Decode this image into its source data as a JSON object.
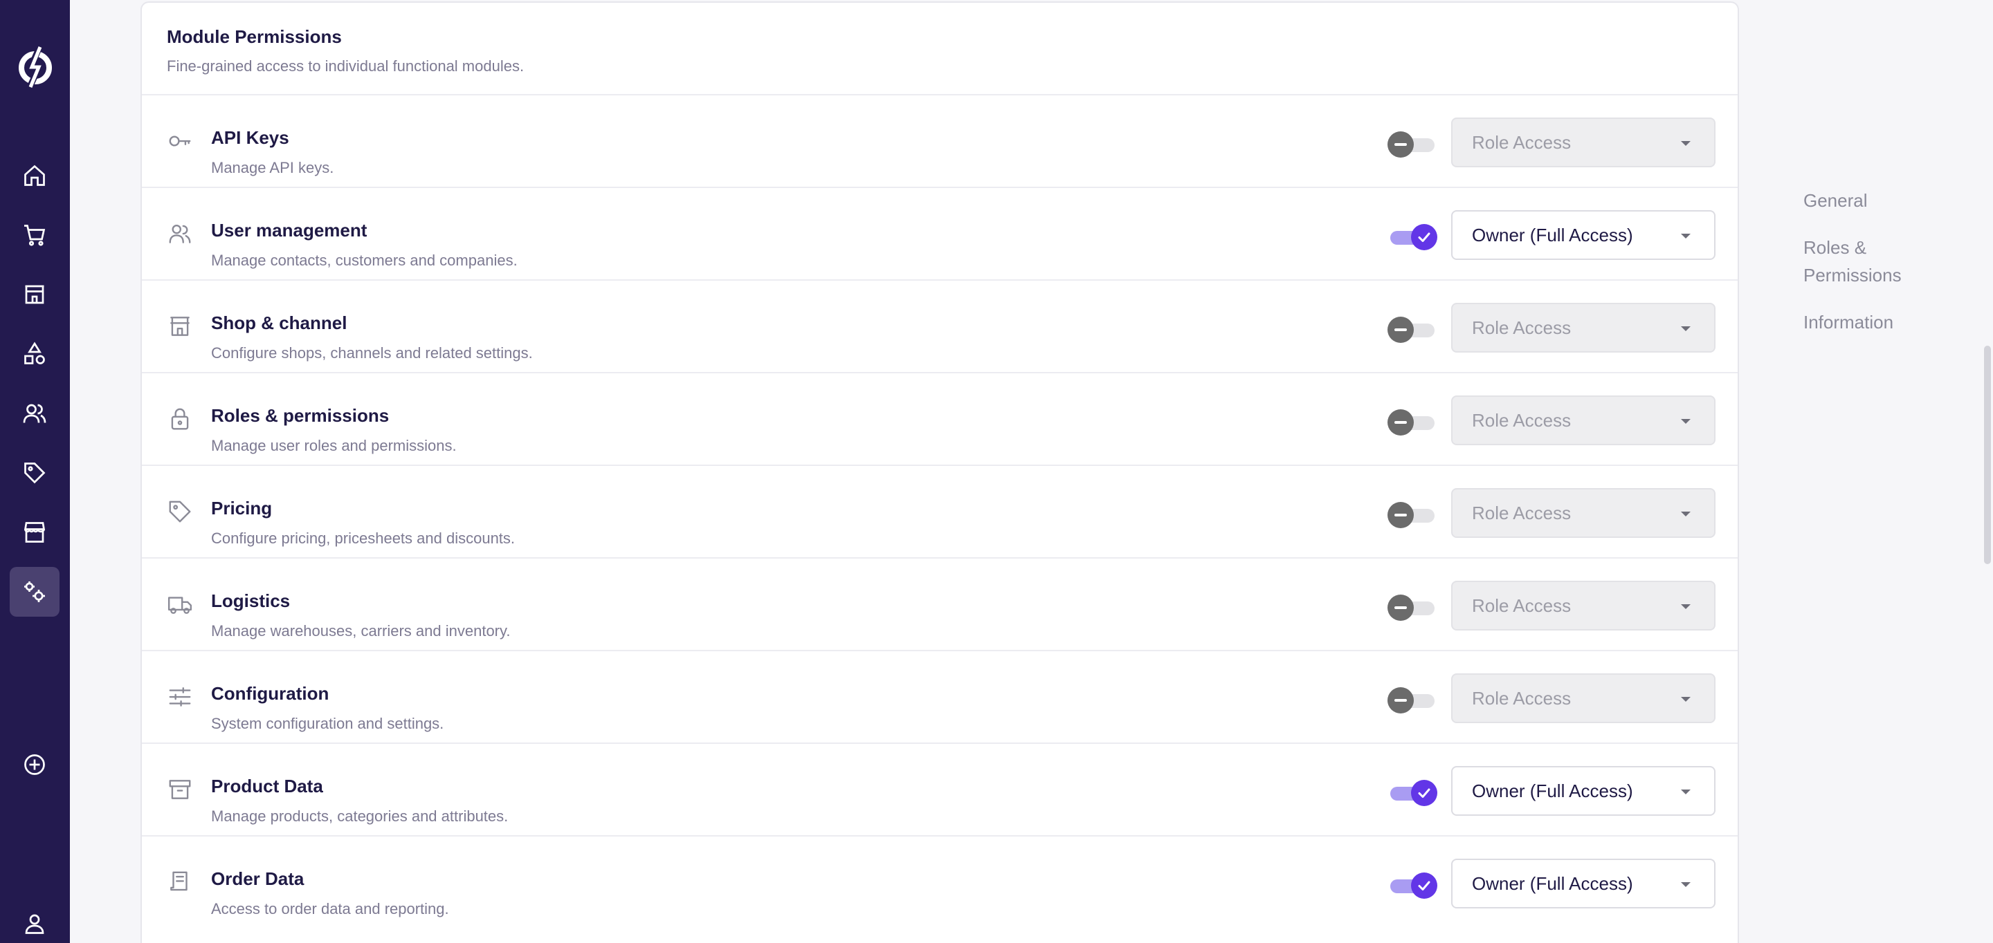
{
  "sidebar": {
    "icons": [
      "logo-icon",
      "home-icon",
      "cart-icon",
      "store-icon",
      "shapes-icon",
      "users-icon",
      "tag-icon",
      "shop-icon",
      "settings-icon",
      "add-circle-icon",
      "user-icon"
    ],
    "active": "settings-icon"
  },
  "card": {
    "title": "Module Permissions",
    "subtitle": "Fine-grained access to individual functional modules."
  },
  "modules": [
    {
      "icon": "key-icon",
      "name": "API Keys",
      "desc": "Manage API keys.",
      "enabled": false,
      "access": "Role Access"
    },
    {
      "icon": "users-icon",
      "name": "User management",
      "desc": "Manage contacts, customers and companies.",
      "enabled": true,
      "access": "Owner (Full Access)"
    },
    {
      "icon": "store-icon",
      "name": "Shop & channel",
      "desc": "Configure shops, channels and related settings.",
      "enabled": false,
      "access": "Role Access"
    },
    {
      "icon": "lock-icon",
      "name": "Roles & permissions",
      "desc": "Manage user roles and permissions.",
      "enabled": false,
      "access": "Role Access"
    },
    {
      "icon": "tag-icon",
      "name": "Pricing",
      "desc": "Configure pricing, pricesheets and discounts.",
      "enabled": false,
      "access": "Role Access"
    },
    {
      "icon": "truck-icon",
      "name": "Logistics",
      "desc": "Manage warehouses, carriers and inventory.",
      "enabled": false,
      "access": "Role Access"
    },
    {
      "icon": "sliders-icon",
      "name": "Configuration",
      "desc": "System configuration and settings.",
      "enabled": false,
      "access": "Role Access"
    },
    {
      "icon": "archive-icon",
      "name": "Product Data",
      "desc": "Manage products, categories and attributes.",
      "enabled": true,
      "access": "Owner (Full Access)"
    },
    {
      "icon": "receipt-icon",
      "name": "Order Data",
      "desc": "Access to order data and reporting.",
      "enabled": true,
      "access": "Owner (Full Access)"
    }
  ],
  "toc": {
    "general": "General",
    "roles": "Roles & Permissions",
    "information": "Information"
  },
  "colors": {
    "sidebar": "#231a4f",
    "accent": "#6236e7",
    "accent_light": "#a99cf2",
    "heading": "#1f1a45",
    "muted": "#7d7a92"
  }
}
